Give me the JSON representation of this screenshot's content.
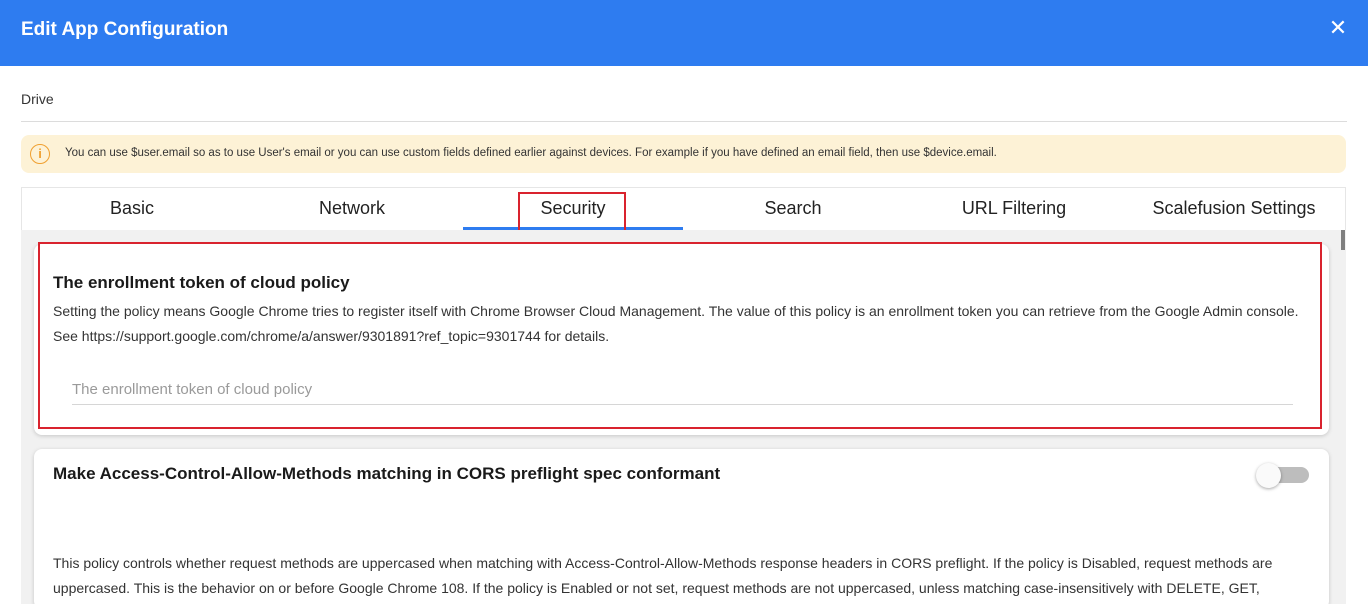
{
  "header": {
    "title": "Edit App Configuration",
    "close_glyph": "✕"
  },
  "app": {
    "name": "Drive"
  },
  "alert": {
    "icon": "info-icon",
    "icon_glyph": "i",
    "text": "You can use $user.email so as to use User's email or you can use custom fields defined earlier against devices. For example if you have defined an email field, then use $device.email."
  },
  "tabs": [
    {
      "label": "Basic",
      "active": false
    },
    {
      "label": "Network",
      "active": false
    },
    {
      "label": "Security",
      "active": true
    },
    {
      "label": "Search",
      "active": false
    },
    {
      "label": "URL Filtering",
      "active": false
    },
    {
      "label": "Scalefusion Settings",
      "active": false
    }
  ],
  "policies": [
    {
      "title": "The enrollment token of cloud policy",
      "description": "Setting the policy means Google Chrome tries to register itself with Chrome Browser Cloud Management. The value of this policy is an enrollment token you can retrieve from the Google Admin console. See https://support.google.com/chrome/a/answer/9301891?ref_topic=9301744 for details.",
      "input_value": "",
      "input_placeholder": "The enrollment token of cloud policy"
    },
    {
      "title": "Make Access-Control-Allow-Methods matching in CORS preflight spec conformant",
      "toggle_on": false,
      "description": "This policy controls whether request methods are uppercased when matching with Access-Control-Allow-Methods response headers in CORS preflight. If the policy is Disabled, request methods are uppercased. This is the behavior on or before Google Chrome 108. If the policy is Enabled or not set, request methods are not uppercased, unless matching case-insensitively with DELETE, GET,"
    }
  ],
  "colors": {
    "header": "#2e7cf0",
    "accent": "#2e7cf0",
    "alert_bg": "#fdf2d6",
    "alert_icon": "#f0a030",
    "highlight": "#d9232e"
  }
}
